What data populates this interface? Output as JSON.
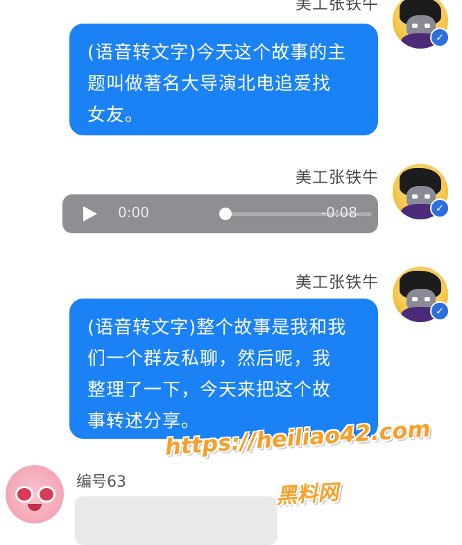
{
  "messages": [
    {
      "sender": "美工张铁牛",
      "text_lines": [
        "(语音转文字)今天这个故事的主",
        "题叫做著名大导演北电追爱找",
        "女友。"
      ]
    },
    {
      "sender": "美工张铁牛",
      "voice": {
        "elapsed": "0:00",
        "remaining": "-0:08",
        "progress": 0
      }
    },
    {
      "sender": "美工张铁牛",
      "text_lines": [
        "(语音转文字)整个故事是我和我",
        "们一个群友私聊，然后呢，我",
        "整理了一下，今天来把这个故",
        "事转述分享。"
      ]
    }
  ],
  "other_user": {
    "name": "编号63"
  },
  "verified_badge": "✓",
  "watermark": {
    "url": "https://heiliao42.com",
    "name": "黑料网"
  },
  "colors": {
    "bubble": "#1b82f6",
    "voice_bar": "#8e8e93",
    "watermark": "#f6a02a"
  }
}
